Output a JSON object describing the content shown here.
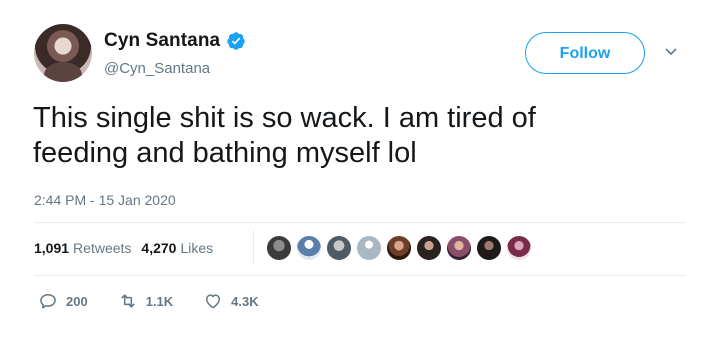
{
  "user": {
    "display_name": "Cyn Santana",
    "handle": "@Cyn_Santana",
    "verified": true
  },
  "follow_label": "Follow",
  "tweet": {
    "text_line1": "This single shit is so wack. I am tired of",
    "text_line2": "feeding and bathing myself lol",
    "timestamp": "2:44 PM - 15 Jan 2020"
  },
  "stats": {
    "retweets_count": "1,091",
    "retweets_label": "Retweets",
    "likes_count": "4,270",
    "likes_label": "Likes"
  },
  "actions": {
    "replies": "200",
    "retweets": "1.1K",
    "likes": "4.3K"
  },
  "colors": {
    "accent": "#1da1f2",
    "secondary_text": "#657786",
    "divider": "#e6ecf0"
  }
}
